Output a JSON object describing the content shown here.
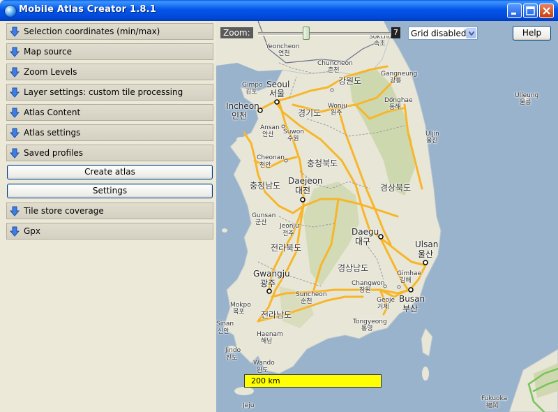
{
  "window": {
    "title": "Mobile Atlas Creator 1.8.1"
  },
  "panel": {
    "sections": [
      {
        "label": "Selection coordinates (min/max)"
      },
      {
        "label": "Map source"
      },
      {
        "label": "Zoom Levels"
      },
      {
        "label": "Layer settings: custom tile processing"
      },
      {
        "label": "Atlas Content"
      },
      {
        "label": "Atlas settings"
      },
      {
        "label": "Saved profiles"
      }
    ],
    "create_atlas_label": "Create atlas",
    "settings_label": "Settings",
    "sections_after": [
      {
        "label": "Tile store coverage"
      },
      {
        "label": "Gpx"
      }
    ]
  },
  "map": {
    "zoom_label": "Zoom:",
    "zoom_value": "7",
    "zoom_level": 7,
    "grid_select_value": "Grid disabled",
    "help_label": "Help",
    "scale_text": "200 km",
    "labels": {
      "sokcho": "Sokcho",
      "sokcho_ko": "속초",
      "yeoncheon": "Yeoncheon",
      "yeoncheon_ko": "연천",
      "chuncheon": "Chuncheon",
      "chuncheon_ko": "춘천",
      "gangwondo": "강원도",
      "gangneung": "Gangneung",
      "gangneung_ko": "강릉",
      "seoul": "Seoul",
      "seoul_ko": "서울",
      "gimpo": "Gimpo",
      "gimpo_ko": "김포",
      "ulleung": "Ulleung",
      "ulleung_ko": "울릉",
      "incheon": "Incheon",
      "incheon_ko": "인천",
      "gyeonggido": "경기도",
      "wonju": "Wonju",
      "wonju_ko": "원주",
      "donghae": "Donghae",
      "donghae_ko": "동해",
      "ansan": "Ansan",
      "ansan_ko": "안산",
      "suwon": "Suwon",
      "suwon_ko": "수원",
      "uljin": "Uljin",
      "uljin_ko": "울진",
      "cheonan": "Cheonan",
      "cheonan_ko": "천안",
      "chungbuk": "충청북도",
      "chungnam": "충청남도",
      "daejeon": "Daejeon",
      "daejeon_ko": "대전",
      "gyeongbuk": "경상북도",
      "gunsan": "Gunsan",
      "gunsan_ko": "군산",
      "jeonju": "Jeonju",
      "jeonju_ko": "전주",
      "daegu": "Daegu",
      "daegu_ko": "대구",
      "jeonbuk": "전라북도",
      "ulsan": "Ulsan",
      "ulsan_ko": "울산",
      "gwangju": "Gwangju",
      "gwangju_ko": "광주",
      "gyeongnam": "경상남도",
      "gimhae": "Gimhae",
      "gimhae_ko": "김해",
      "changwon": "Changwon",
      "changwon_ko": "창원",
      "mokpo": "Mokpo",
      "mokpo_ko": "목포",
      "suncheon": "Suncheon",
      "suncheon_ko": "순천",
      "geoje": "Geoje",
      "geoje_ko": "거제",
      "busan": "Busan",
      "busan_ko": "부산",
      "jeonnam": "전라남도",
      "tongyeong": "Tongyeong",
      "tongyeong_ko": "통영",
      "sinan": "Sinan",
      "sinan_ko": "신안",
      "haenam": "Haenam",
      "haenam_ko": "해남",
      "jindo": "Jindo",
      "jindo_ko": "진도",
      "wando": "Wando",
      "wando_ko": "완도",
      "fukuoka": "Fukuoka",
      "fukuoka_ko": "福岡",
      "jeju": "Jeju"
    }
  },
  "colors": {
    "sea": "#99b3cc",
    "land": "#e8e6d6",
    "land_green": "#c9d5a8",
    "highway": "#f7b62a",
    "title_bar": "#0054e3",
    "scale_bar": "#ffff00"
  },
  "icons": {
    "section_arrow": "down-arrow-icon",
    "app": "globe-icon",
    "minimize": "minimize-icon",
    "maximize": "maximize-icon",
    "close": "close-icon"
  }
}
